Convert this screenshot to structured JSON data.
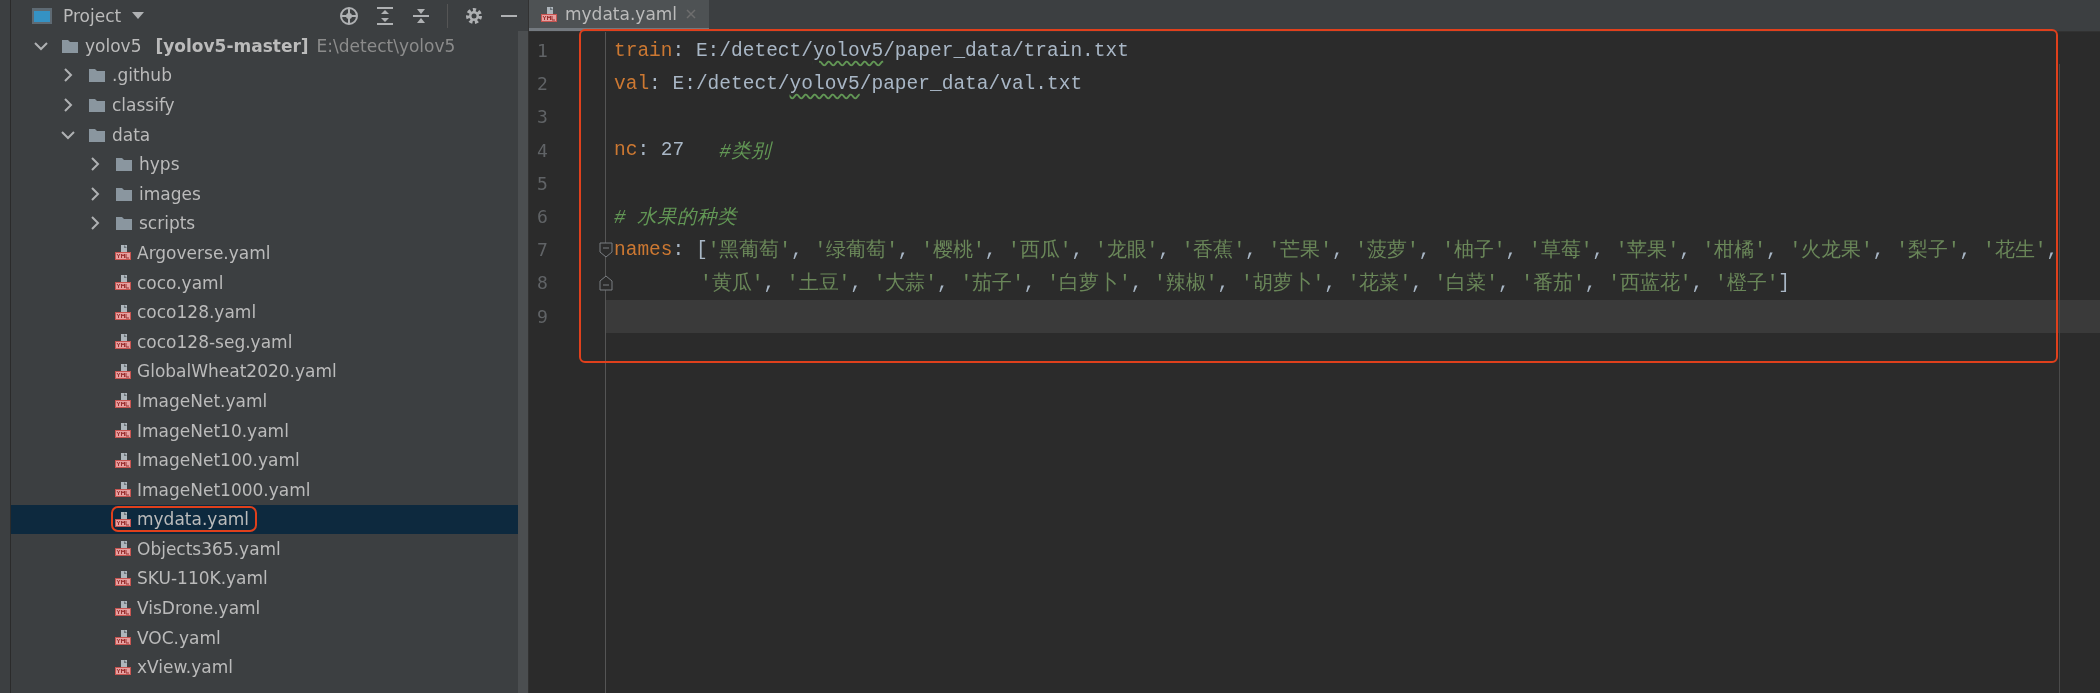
{
  "project_panel": {
    "title": "Project",
    "tree": [
      {
        "kind": "module",
        "name": "yolov5",
        "module": "[yolov5-master]",
        "path": "E:\\detect\\yolov5",
        "expanded": true,
        "selected": false,
        "children": [
          {
            "kind": "folder",
            "name": ".github",
            "expanded": false,
            "selected": false
          },
          {
            "kind": "folder",
            "name": "classify",
            "expanded": false,
            "selected": false
          },
          {
            "kind": "folder",
            "name": "data",
            "expanded": true,
            "selected": false,
            "children": [
              {
                "kind": "folder",
                "name": "hyps",
                "expanded": false,
                "selected": false
              },
              {
                "kind": "folder",
                "name": "images",
                "expanded": false,
                "selected": false
              },
              {
                "kind": "folder",
                "name": "scripts",
                "expanded": false,
                "selected": false
              },
              {
                "kind": "yaml",
                "name": "Argoverse.yaml",
                "selected": false
              },
              {
                "kind": "yaml",
                "name": "coco.yaml",
                "selected": false
              },
              {
                "kind": "yaml",
                "name": "coco128.yaml",
                "selected": false
              },
              {
                "kind": "yaml",
                "name": "coco128-seg.yaml",
                "selected": false
              },
              {
                "kind": "yaml",
                "name": "GlobalWheat2020.yaml",
                "selected": false
              },
              {
                "kind": "yaml",
                "name": "ImageNet.yaml",
                "selected": false
              },
              {
                "kind": "yaml",
                "name": "ImageNet10.yaml",
                "selected": false
              },
              {
                "kind": "yaml",
                "name": "ImageNet100.yaml",
                "selected": false
              },
              {
                "kind": "yaml",
                "name": "ImageNet1000.yaml",
                "selected": false
              },
              {
                "kind": "yaml",
                "name": "mydata.yaml",
                "selected": true,
                "highlighted": true
              },
              {
                "kind": "yaml",
                "name": "Objects365.yaml",
                "selected": false
              },
              {
                "kind": "yaml",
                "name": "SKU-110K.yaml",
                "selected": false
              },
              {
                "kind": "yaml",
                "name": "VisDrone.yaml",
                "selected": false
              },
              {
                "kind": "yaml",
                "name": "VOC.yaml",
                "selected": false
              },
              {
                "kind": "yaml",
                "name": "xView.yaml",
                "selected": false
              }
            ]
          }
        ]
      }
    ]
  },
  "editor": {
    "highlighted": true,
    "tabs": [
      {
        "label": "mydata.yaml",
        "selected": true
      }
    ],
    "lines": [
      {
        "number": "1",
        "current": false,
        "segments": [
          {
            "kind": "key",
            "text": "train"
          },
          {
            "kind": "plain",
            "text": ": E:/detect/"
          },
          {
            "kind": "typo",
            "text": "yolov5"
          },
          {
            "kind": "plain",
            "text": "/paper_data/train.txt"
          }
        ]
      },
      {
        "number": "2",
        "current": false,
        "segments": [
          {
            "kind": "key",
            "text": "val"
          },
          {
            "kind": "plain",
            "text": ": E:/detect/"
          },
          {
            "kind": "typo",
            "text": "yolov5"
          },
          {
            "kind": "plain",
            "text": "/paper_data/val.txt"
          }
        ]
      },
      {
        "number": "3",
        "current": false
      },
      {
        "number": "4",
        "current": false,
        "segments": [
          {
            "kind": "key",
            "text": "nc"
          },
          {
            "kind": "plain",
            "text": ": 27   "
          },
          {
            "kind": "comment",
            "text": "#类别"
          }
        ]
      },
      {
        "number": "5",
        "current": false
      },
      {
        "number": "6",
        "current": false,
        "segments": [
          {
            "kind": "comment",
            "text": "# 水果的种类"
          }
        ]
      },
      {
        "number": "7",
        "current": false,
        "fold_open": true,
        "segments": [
          {
            "kind": "key",
            "text": "names"
          },
          {
            "kind": "plain",
            "text": ": ["
          },
          {
            "kind": "string",
            "text": "'黑葡萄'"
          },
          {
            "kind": "plain",
            "text": ", "
          },
          {
            "kind": "string",
            "text": "'绿葡萄'"
          },
          {
            "kind": "plain",
            "text": ", "
          },
          {
            "kind": "string",
            "text": "'樱桃'"
          },
          {
            "kind": "plain",
            "text": ", "
          },
          {
            "kind": "string",
            "text": "'西瓜'"
          },
          {
            "kind": "plain",
            "text": ", "
          },
          {
            "kind": "string",
            "text": "'龙眼'"
          },
          {
            "kind": "plain",
            "text": ", "
          },
          {
            "kind": "string",
            "text": "'香蕉'"
          },
          {
            "kind": "plain",
            "text": ", "
          },
          {
            "kind": "string",
            "text": "'芒果'"
          },
          {
            "kind": "plain",
            "text": ", "
          },
          {
            "kind": "string",
            "text": "'菠萝'"
          },
          {
            "kind": "plain",
            "text": ", "
          },
          {
            "kind": "string",
            "text": "'柚子'"
          },
          {
            "kind": "plain",
            "text": ", "
          },
          {
            "kind": "string",
            "text": "'草莓'"
          },
          {
            "kind": "plain",
            "text": ", "
          },
          {
            "kind": "string",
            "text": "'苹果'"
          },
          {
            "kind": "plain",
            "text": ", "
          },
          {
            "kind": "string",
            "text": "'柑橘'"
          },
          {
            "kind": "plain",
            "text": ", "
          },
          {
            "kind": "string",
            "text": "'火龙果'"
          },
          {
            "kind": "plain",
            "text": ", "
          },
          {
            "kind": "string",
            "text": "'梨子'"
          },
          {
            "kind": "plain",
            "text": ", "
          },
          {
            "kind": "string",
            "text": "'花生'"
          },
          {
            "kind": "plain",
            "text": ","
          }
        ]
      },
      {
        "number": "8",
        "current": false,
        "fold_close": true,
        "continuation": true,
        "segments": [
          {
            "kind": "string",
            "text": "'黄瓜'"
          },
          {
            "kind": "plain",
            "text": ", "
          },
          {
            "kind": "string",
            "text": "'土豆'"
          },
          {
            "kind": "plain",
            "text": ", "
          },
          {
            "kind": "string",
            "text": "'大蒜'"
          },
          {
            "kind": "plain",
            "text": ", "
          },
          {
            "kind": "string",
            "text": "'茄子'"
          },
          {
            "kind": "plain",
            "text": ", "
          },
          {
            "kind": "string",
            "text": "'白萝卜'"
          },
          {
            "kind": "plain",
            "text": ", "
          },
          {
            "kind": "string",
            "text": "'辣椒'"
          },
          {
            "kind": "plain",
            "text": ", "
          },
          {
            "kind": "string",
            "text": "'胡萝卜'"
          },
          {
            "kind": "plain",
            "text": ", "
          },
          {
            "kind": "string",
            "text": "'花菜'"
          },
          {
            "kind": "plain",
            "text": ", "
          },
          {
            "kind": "string",
            "text": "'白菜'"
          },
          {
            "kind": "plain",
            "text": ", "
          },
          {
            "kind": "string",
            "text": "'番茄'"
          },
          {
            "kind": "plain",
            "text": ", "
          },
          {
            "kind": "string",
            "text": "'西蓝花'"
          },
          {
            "kind": "plain",
            "text": ", "
          },
          {
            "kind": "string",
            "text": "'橙子'"
          },
          {
            "kind": "plain",
            "text": "]"
          }
        ]
      },
      {
        "number": "9",
        "current": true
      }
    ]
  }
}
